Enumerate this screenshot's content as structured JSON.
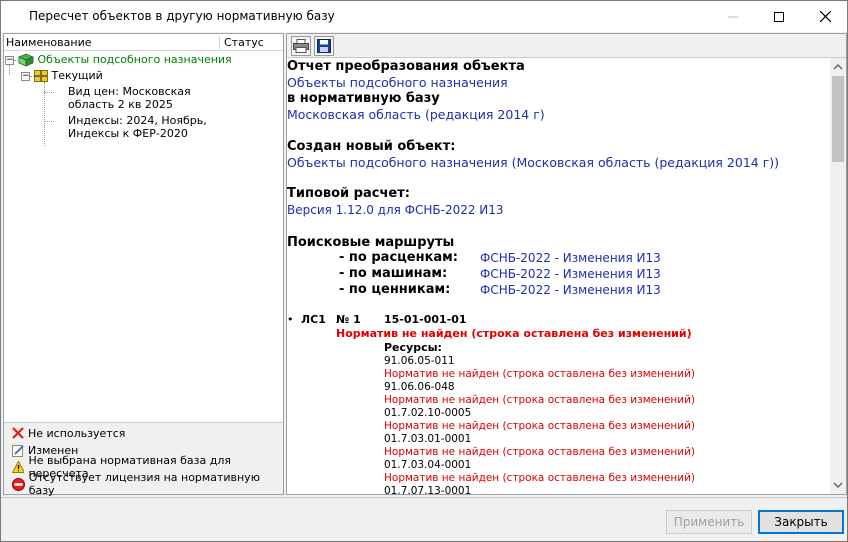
{
  "window": {
    "title": "Пересчет объектов в другую нормативную базу"
  },
  "left": {
    "columns": {
      "name": "Наименование",
      "status": "Статус"
    },
    "tree": {
      "root": "Объекты подсобного назначения",
      "current": "Текущий",
      "leaf1": [
        "Вид цен: Московская",
        "область 2 кв 2025"
      ],
      "leaf2": [
        "Индексы: 2024, Ноябрь,",
        "Индексы к ФЕР-2020"
      ]
    },
    "legend": [
      {
        "icon": "red-x-icon",
        "label": "Не используется"
      },
      {
        "icon": "edit-note-icon",
        "label": "Изменен"
      },
      {
        "icon": "warning-icon",
        "label": "Не выбрана нормативная база для пересчета"
      },
      {
        "icon": "no-entry-icon",
        "label": "Отсутствует лицензия на нормативную базу"
      }
    ]
  },
  "report": {
    "h1": "Отчет преобразования объекта",
    "object": "Объекты подсобного назначения",
    "h2": "в нормативную базу",
    "base": "Московская область (редакция 2014 г)",
    "h3": "Создан новый объект:",
    "new_object": "Объекты подсобного назначения (Московская область (редакция 2014 г))",
    "h4": "Типовой расчет:",
    "version": "Версия 1.12.0 для ФСНБ-2022 И13",
    "h5": "Поисковые маршруты",
    "routes": [
      {
        "label": "- по расценкам:",
        "value": "ФСНБ-2022 - Изменения И13"
      },
      {
        "label": "- по машинам:",
        "value": "ФСНБ-2022 - Изменения И13"
      },
      {
        "label": "- по ценникам:",
        "value": "ФСНБ-2022 - Изменения И13"
      }
    ],
    "entry": {
      "bullet": "•",
      "ls": "ЛС1",
      "num": "№ 1",
      "code": "15-01-001-01",
      "status": "Норматив не найден (строка оставлена без изменений)",
      "resources_label": "Ресурсы:",
      "resources": [
        {
          "code": "91.06.05-011",
          "status": "Норматив не найден (строка оставлена без изменений)"
        },
        {
          "code": "91.06.06-048",
          "status": "Норматив не найден (строка оставлена без изменений)"
        },
        {
          "code": "01.7.02.10-0005",
          "status": "Норматив не найден (строка оставлена без изменений)"
        },
        {
          "code": "01.7.03.01-0001",
          "status": "Норматив не найден (строка оставлена без изменений)"
        },
        {
          "code": "01.7.03.04-0001",
          "status": "Норматив не найден (строка оставлена без изменений)"
        },
        {
          "code": "01.7.07.13-0001",
          "status": ""
        }
      ]
    }
  },
  "buttons": {
    "apply": "Применить",
    "close": "Закрыть"
  },
  "colors": {
    "link_blue": "#1f2fb0",
    "error_red": "#e00000",
    "tree_green": "#008000"
  }
}
